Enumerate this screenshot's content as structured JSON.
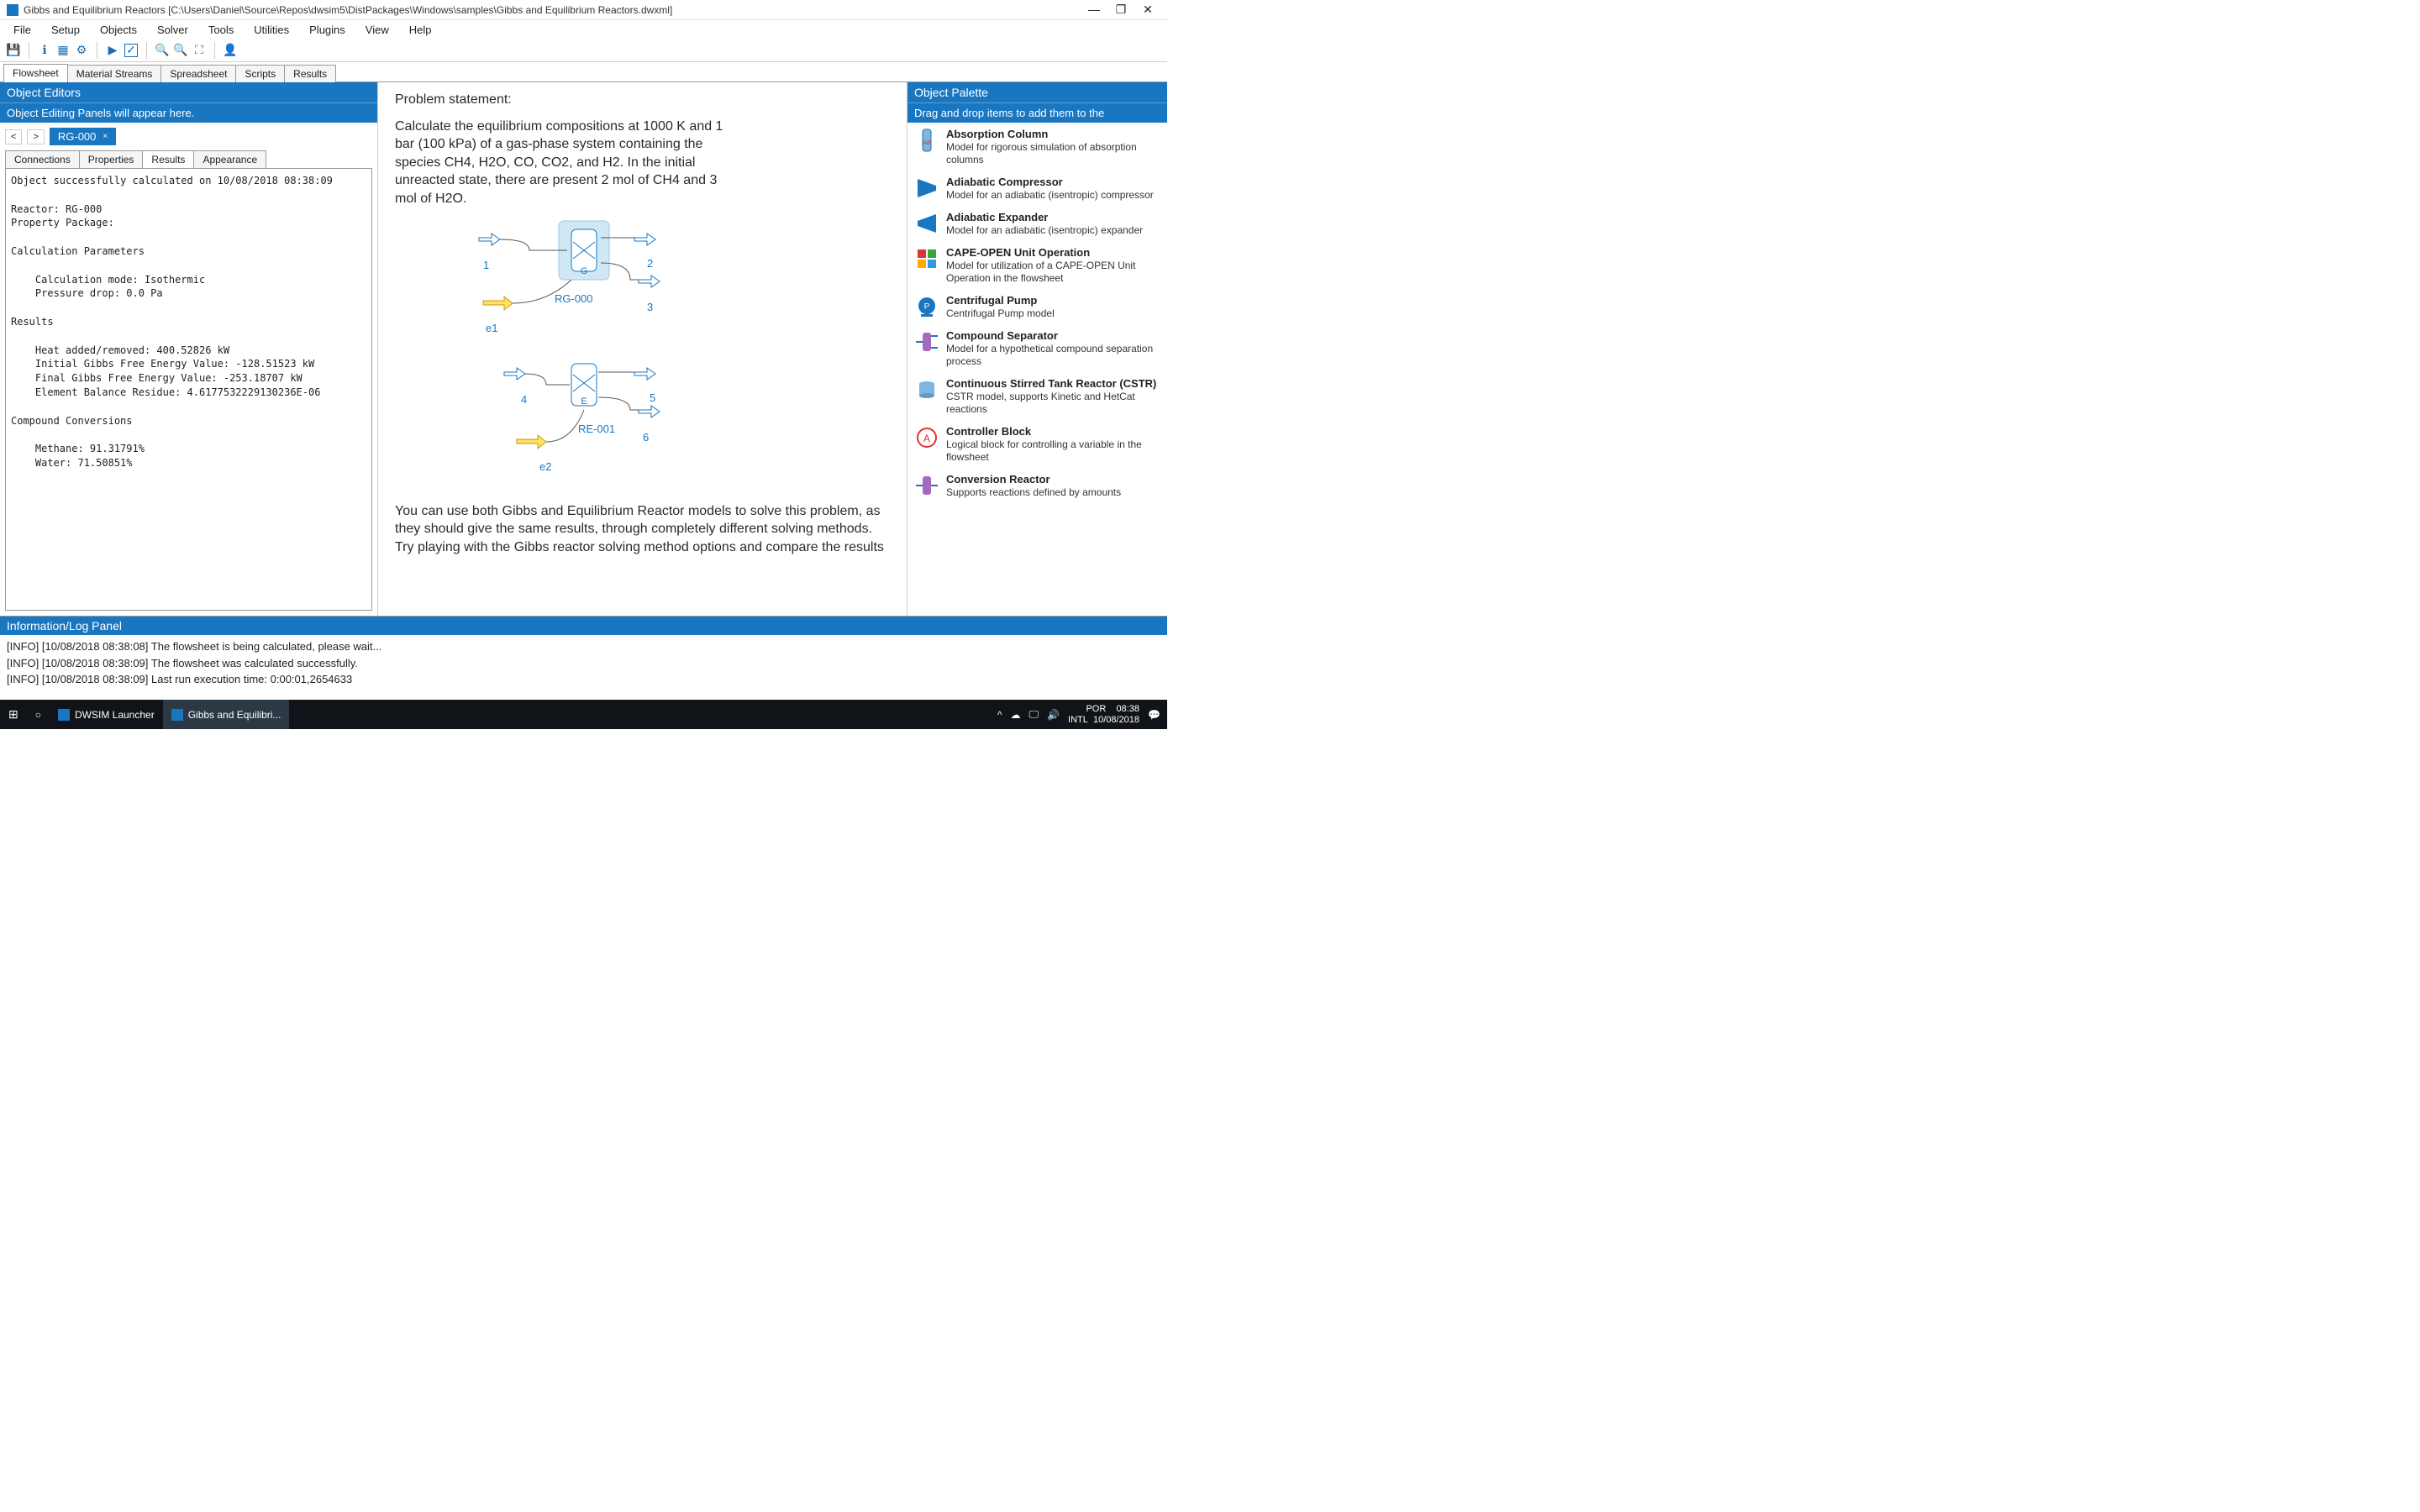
{
  "title": "Gibbs and Equilibrium Reactors [C:\\Users\\Daniel\\Source\\Repos\\dwsim5\\DistPackages\\Windows\\samples\\Gibbs and Equilibrium Reactors.dwxml]",
  "menus": [
    "File",
    "Setup",
    "Objects",
    "Solver",
    "Tools",
    "Utilities",
    "Plugins",
    "View",
    "Help"
  ],
  "doctabs": [
    "Flowsheet",
    "Material Streams",
    "Spreadsheet",
    "Scripts",
    "Results"
  ],
  "leftPanel": {
    "title": "Object Editors",
    "subhead": "Object Editing Panels will appear here.",
    "nav_prev": "<",
    "nav_next": ">",
    "objTab": "RG-000",
    "close": "×",
    "innerTabs": [
      "Connections",
      "Properties",
      "Results",
      "Appearance"
    ],
    "results": "Object successfully calculated on 10/08/2018 08:38:09\n\nReactor: RG-000\nProperty Package:\n\nCalculation Parameters\n\n    Calculation mode: Isothermic\n    Pressure drop: 0.0 Pa\n\nResults\n\n    Heat added/removed: 400.52826 kW\n    Initial Gibbs Free Energy Value: -128.51523 kW\n    Final Gibbs Free Energy Value: -253.18707 kW\n    Element Balance Residue: 4.6177532229130236E-06\n\nCompound Conversions\n\n    Methane: 91.31791%\n    Water: 71.50851%"
  },
  "canvas": {
    "problemTitle": "Problem statement:",
    "problemBody": "Calculate the equilibrium compositions at 1000 K and 1 bar (100 kPa) of a gas-phase system containing the species CH4, H2O, CO, CO2, and H2. In the initial unreacted state, there are present 2 mol of CH4 and 3 mol of H2O.",
    "d1": {
      "s1": "1",
      "s2": "2",
      "s3": "3",
      "e": "e1",
      "r": "RG-000",
      "g": "G"
    },
    "d2": {
      "s1": "4",
      "s2": "5",
      "s3": "6",
      "e": "e2",
      "r": "RE-001",
      "g": "E"
    },
    "bottomText": "You can use both Gibbs and Equilibrium Reactor models to solve this problem, as they should give the same results, through completely different solving methods. Try playing with the Gibbs reactor solving method options and compare the results"
  },
  "rightPanel": {
    "title": "Object Palette",
    "subhead": "Drag and drop items to add them to the",
    "items": [
      {
        "name": "Absorption Column",
        "desc": "Model for rigorous simulation of absorption columns"
      },
      {
        "name": "Adiabatic Compressor",
        "desc": "Model for an adiabatic (isentropic) compressor"
      },
      {
        "name": "Adiabatic Expander",
        "desc": "Model for an adiabatic (isentropic) expander"
      },
      {
        "name": "CAPE-OPEN Unit Operation",
        "desc": "Model for utilization of a CAPE-OPEN Unit Operation in the flowsheet"
      },
      {
        "name": "Centrifugal Pump",
        "desc": "Centrifugal Pump model"
      },
      {
        "name": "Compound Separator",
        "desc": "Model for a hypothetical compound separation process"
      },
      {
        "name": "Continuous Stirred Tank Reactor (CSTR)",
        "desc": "CSTR model, supports Kinetic and HetCat reactions"
      },
      {
        "name": "Controller Block",
        "desc": "Logical block for controlling a variable in the flowsheet"
      },
      {
        "name": "Conversion Reactor",
        "desc": "Supports reactions defined by amounts"
      }
    ]
  },
  "log": {
    "title": "Information/Log Panel",
    "lines": [
      "[INFO] [10/08/2018 08:38:08] The flowsheet is being calculated, please wait...",
      "[INFO] [10/08/2018 08:38:09] The flowsheet was calculated successfully.",
      "[INFO] [10/08/2018 08:38:09] Last run execution time: 0:00:01,2654633"
    ]
  },
  "taskbar": {
    "app1": "DWSIM Launcher",
    "app2": "Gibbs and Equilibri...",
    "lang": "POR",
    "kb": "INTL",
    "time": "08:38",
    "date": "10/08/2018"
  }
}
